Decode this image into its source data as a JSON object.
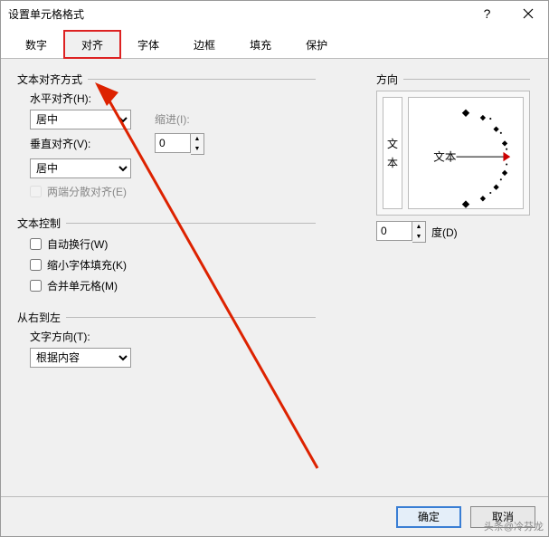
{
  "window": {
    "title": "设置单元格格式"
  },
  "tabs": {
    "number": "数字",
    "alignment": "对齐",
    "font": "字体",
    "border": "边框",
    "fill": "填充",
    "protection": "保护"
  },
  "textAlign": {
    "groupTitle": "文本对齐方式",
    "hLabel": "水平对齐(H):",
    "hValue": "居中",
    "indentLabel": "缩进(I):",
    "indentValue": "0",
    "vLabel": "垂直对齐(V):",
    "vValue": "居中",
    "distributedLabel": "两端分散对齐(E)"
  },
  "textControl": {
    "groupTitle": "文本控制",
    "wrapLabel": "自动换行(W)",
    "shrinkLabel": "缩小字体填充(K)",
    "mergeLabel": "合并单元格(M)"
  },
  "rtl": {
    "groupTitle": "从右到左",
    "dirLabel": "文字方向(T):",
    "dirValue": "根据内容"
  },
  "orientation": {
    "groupTitle": "方向",
    "vtext1": "文",
    "vtext2": "本",
    "htext": "文本",
    "degValue": "0",
    "degLabel": "度(D)"
  },
  "footer": {
    "ok": "确定",
    "cancel": "取消"
  },
  "watermark": "头条@冷芬龙"
}
